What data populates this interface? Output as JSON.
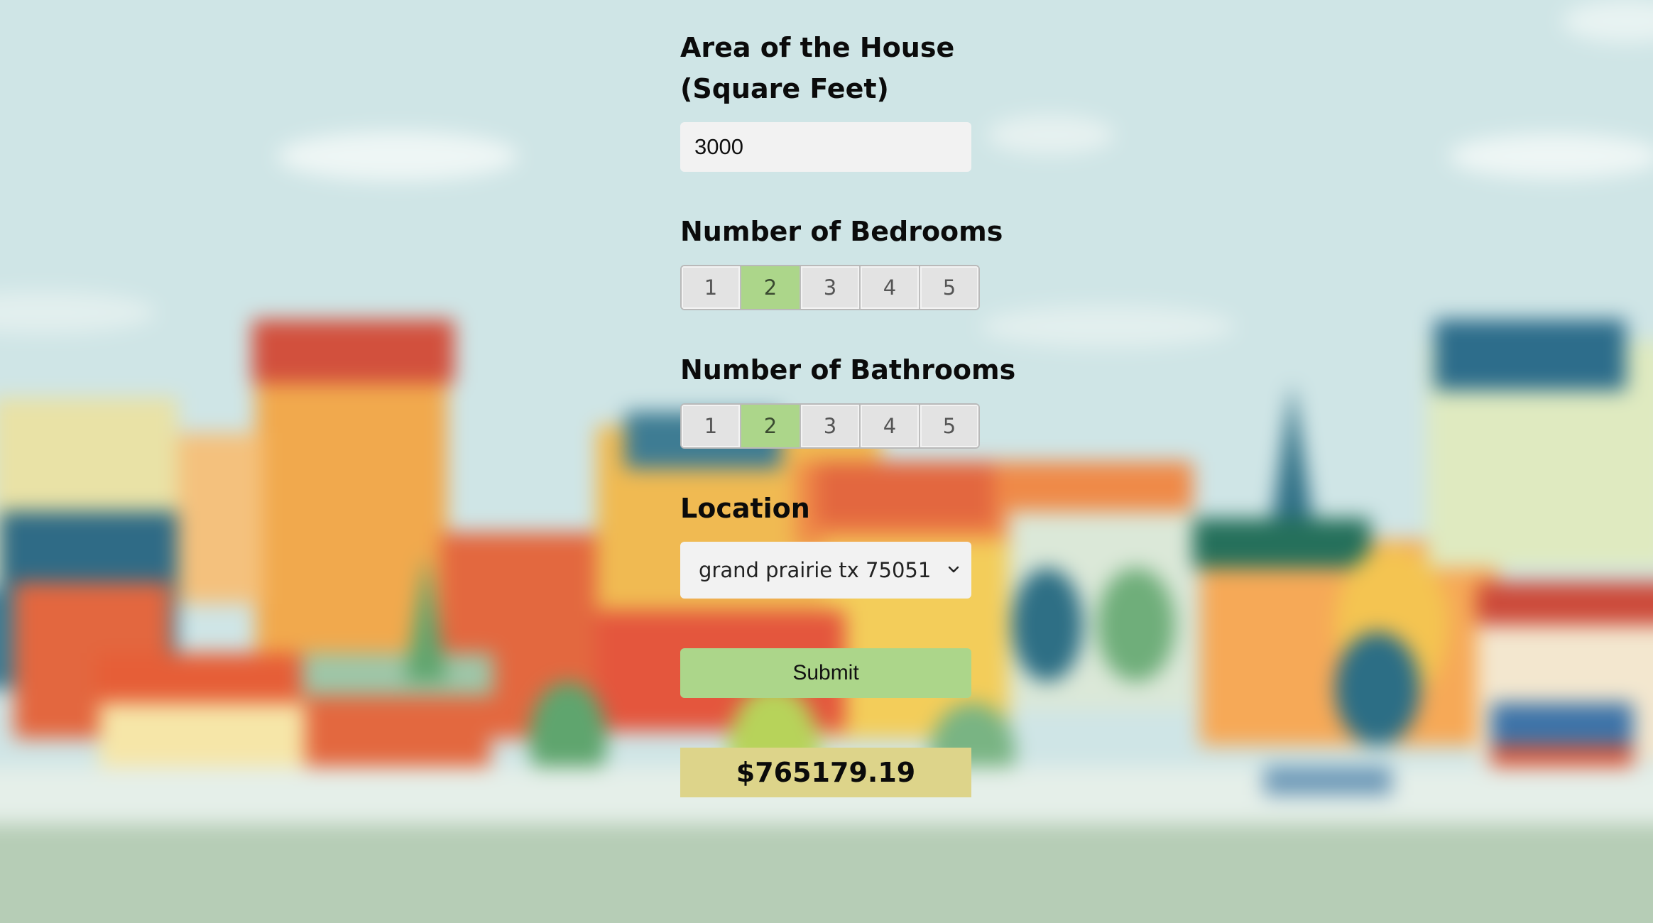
{
  "form": {
    "area_label": "Area of the House (Square Feet)",
    "area_value": "3000",
    "bedrooms_label": "Number of Bedrooms",
    "bedroom_options": [
      "1",
      "2",
      "3",
      "4",
      "5"
    ],
    "bedrooms_selected": "2",
    "bathrooms_label": "Number of Bathrooms",
    "bathroom_options": [
      "1",
      "2",
      "3",
      "4",
      "5"
    ],
    "bathrooms_selected": "2",
    "location_label": "Location",
    "location_value": "grand prairie tx 75051",
    "submit_label": "Submit",
    "result": "$765179.19"
  },
  "colors": {
    "selected_option": "#acd68a",
    "submit_button": "#acd68a",
    "result_box": "#ddd48a",
    "input_bg": "#f2f2f2"
  },
  "icons": {
    "location_dropdown": "chevron-down-icon"
  }
}
